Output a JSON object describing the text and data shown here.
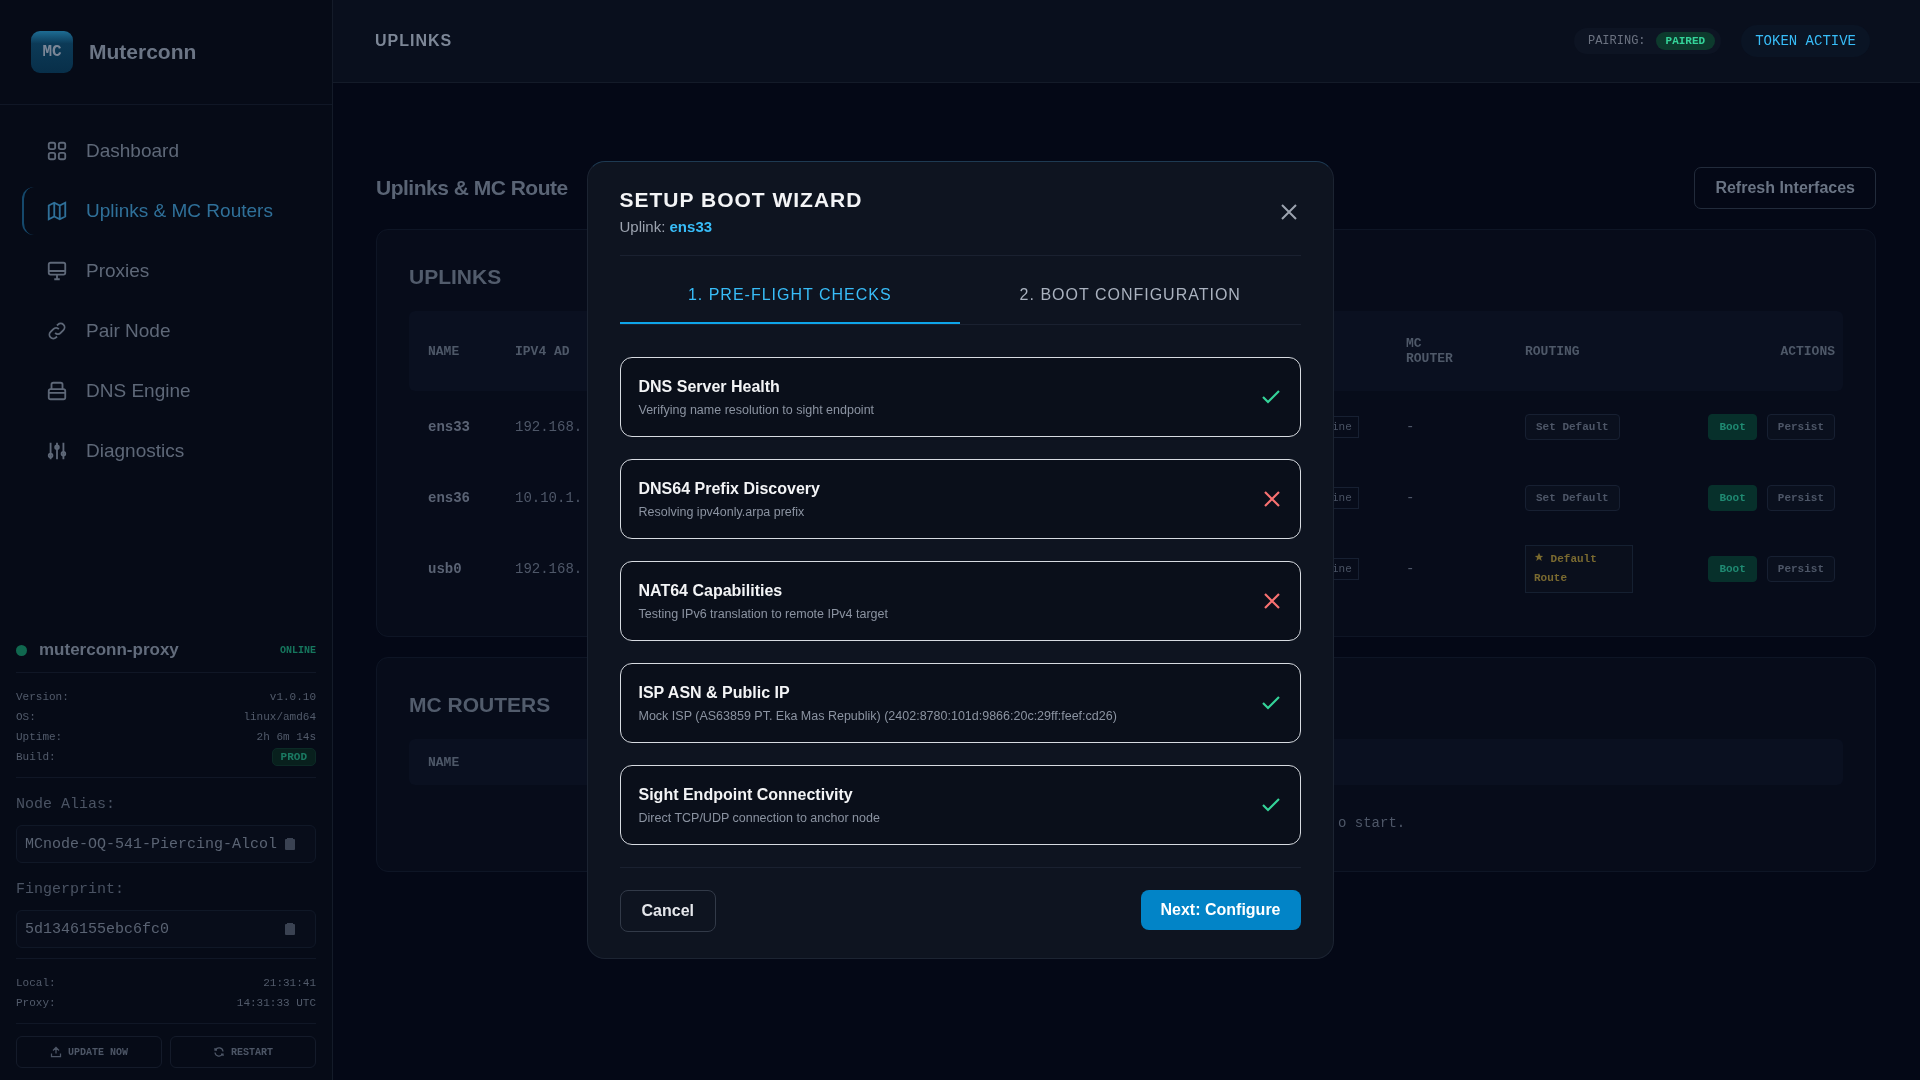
{
  "brand": {
    "logo": "MC",
    "name": "Muterconn"
  },
  "nav": [
    {
      "label": "Dashboard",
      "selected": false
    },
    {
      "label": "Uplinks & MC Routers",
      "selected": true
    },
    {
      "label": "Proxies",
      "selected": false
    },
    {
      "label": "Pair Node",
      "selected": false
    },
    {
      "label": "DNS Engine",
      "selected": false
    },
    {
      "label": "Diagnostics",
      "selected": false
    }
  ],
  "node": {
    "name": "muterconn-proxy",
    "online": true,
    "status": "ONLINE",
    "info": [
      {
        "label": "Version:",
        "value": "v1.0.10",
        "kind": "text"
      },
      {
        "label": "OS:",
        "value": "linux/amd64",
        "kind": "text"
      },
      {
        "label": "Uptime:",
        "value": "2h 6m 14s",
        "kind": "text"
      },
      {
        "label": "Build:",
        "value": "PROD",
        "kind": "badge"
      }
    ],
    "alias_label": "Node Alias:",
    "alias": "MCnode-OQ-541-Piercing-Alcol",
    "fingerprint_label": "Fingerprint:",
    "fingerprint": "5d1346155ebc6fc0",
    "clock": [
      {
        "label": "Local:",
        "value": "21:31:41"
      },
      {
        "label": "Proxy:",
        "value": "14:31:33 UTC"
      }
    ],
    "actions": [
      "UPDATE NOW",
      "RESTART"
    ]
  },
  "topbar": {
    "title": "UPLINKS",
    "pairing_label": "PAIRING:",
    "pairing": "PAIRED",
    "token": "TOKEN ACTIVE"
  },
  "page": {
    "title": "Uplinks & MC Route",
    "refresh": "Refresh Interfaces"
  },
  "uplinks": {
    "title": "UPLINKS",
    "columns": [
      "NAME",
      "IPV4 AD",
      "MC ROUTER",
      "ROUTING",
      "ACTIONS"
    ],
    "rows": [
      {
        "name": "ens33",
        "ipv4": "192.168.",
        "status": "ine",
        "router": "-",
        "routing": {
          "kind": "button",
          "label": "Set Default"
        },
        "actions": [
          "Boot",
          "Persist"
        ]
      },
      {
        "name": "ens36",
        "ipv4": "10.10.1.",
        "status": "ine",
        "router": "-",
        "routing": {
          "kind": "button",
          "label": "Set Default"
        },
        "actions": [
          "Boot",
          "Persist"
        ]
      },
      {
        "name": "usb0",
        "ipv4": "192.168.",
        "status": "ine",
        "router": "-",
        "routing": {
          "kind": "default",
          "label": "Default Route"
        },
        "actions": [
          "Boot",
          "Persist"
        ]
      }
    ]
  },
  "routers": {
    "title": "MC ROUTERS",
    "columns": [
      "NAME"
    ],
    "empty": "o start."
  },
  "wizard": {
    "title": "SETUP BOOT WIZARD",
    "uplink_label": "Uplink:",
    "uplink": "ens33",
    "tabs": [
      {
        "label": "1. PRE-FLIGHT CHECKS",
        "selected": true
      },
      {
        "label": "2. BOOT CONFIGURATION",
        "selected": false
      }
    ],
    "checks": [
      {
        "title": "DNS Server Health",
        "detail": "Verifying name resolution to sight endpoint",
        "passed": true
      },
      {
        "title": "DNS64 Prefix Discovery",
        "detail": "Resolving ipv4only.arpa prefix",
        "passed": false
      },
      {
        "title": "NAT64 Capabilities",
        "detail": "Testing IPv6 translation to remote IPv4 target",
        "passed": false
      },
      {
        "title": "ISP ASN & Public IP",
        "detail": "Mock ISP (AS63859 PT. Eka Mas Republik) (2402:8780:101d:9866:20c:29ff:feef:cd26)",
        "passed": true
      },
      {
        "title": "Sight Endpoint Connectivity",
        "detail": "Direct TCP/UDP connection to anchor node",
        "passed": true
      }
    ],
    "cancel": "Cancel",
    "next": "Next: Configure"
  }
}
